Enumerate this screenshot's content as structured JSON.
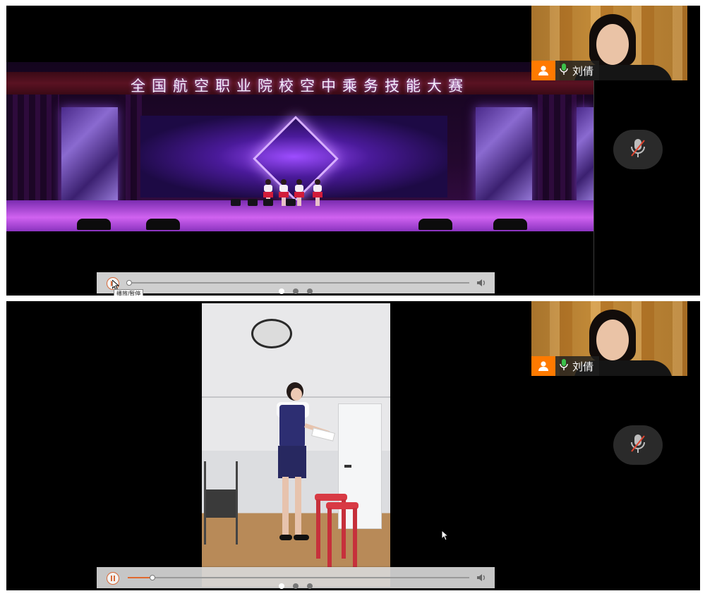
{
  "panels": [
    {
      "video": {
        "banner_text": "全国航空职业院校空中乘务技能大赛"
      },
      "participant": {
        "name": "刘倩",
        "icon": "user-icon",
        "mic_icon": "microphone-icon"
      },
      "mute_icon": "microphone-muted-icon",
      "playback": {
        "state": "paused",
        "progress": 0.0,
        "play_tooltip": "播放/暂停",
        "page_dots": 3,
        "active_dot": 0
      }
    },
    {
      "participant": {
        "name": "刘倩",
        "icon": "user-icon",
        "mic_icon": "microphone-icon"
      },
      "mute_icon": "microphone-muted-icon",
      "playback": {
        "state": "playing",
        "progress": 0.07,
        "page_dots": 3,
        "active_dot": 0
      }
    }
  ],
  "colors": {
    "accent": "#ff7a00",
    "progress": "#e0692f",
    "mute_slash": "#e0442f"
  }
}
